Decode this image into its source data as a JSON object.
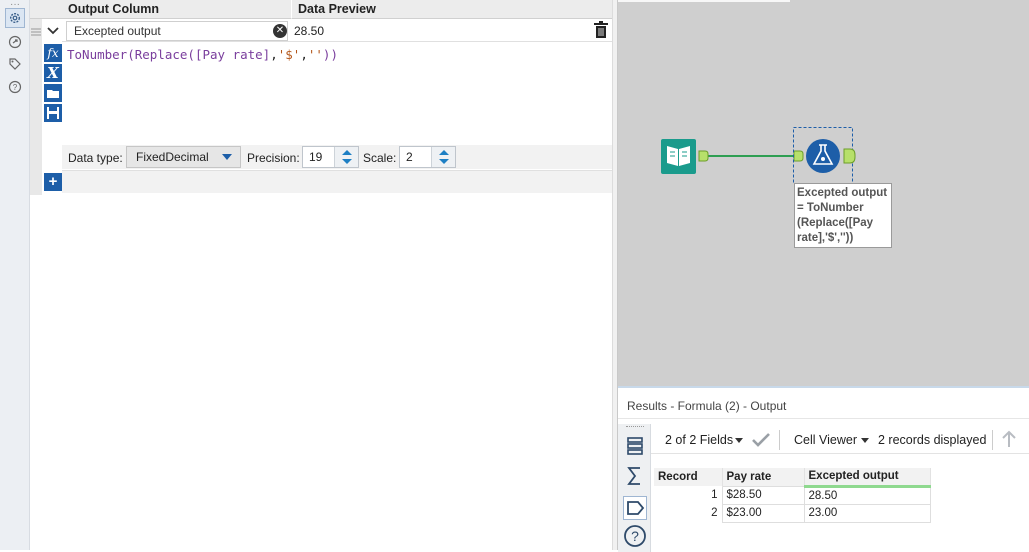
{
  "grid": {
    "headers": {
      "output_column": "Output Column",
      "data_preview": "Data Preview"
    },
    "row": {
      "output_field_name": "Excepted output",
      "preview_value": "28.50",
      "expression": {
        "func1": "ToNumber(",
        "func2": "Replace(",
        "field": "[Pay rate]",
        "comma1": ",",
        "arg1": "'$'",
        "comma2": ",",
        "arg2": "''",
        "close": "))"
      }
    },
    "type_bar": {
      "data_type_label": "Data type:",
      "data_type_value": "FixedDecimal",
      "precision_label": "Precision:",
      "precision_value": "19",
      "scale_label": "Scale:",
      "scale_value": "2"
    }
  },
  "canvas": {
    "annotation_lines": [
      "Excepted output",
      "= ToNumber",
      "(Replace([Pay",
      "rate],'$',''))"
    ],
    "connection_color": "#2e9e52",
    "input_tool_color": "#1a9b8c",
    "formula_tool_color": "#1d5ea8"
  },
  "results": {
    "title": "Results - Formula (2) - Output",
    "fields_selector": "2 of 2 Fields",
    "viewer_selector": "Cell Viewer",
    "record_count": "2 records displayed",
    "columns": [
      "Record",
      "Pay rate",
      "Excepted output"
    ],
    "rows": [
      {
        "record": "1",
        "pay_rate": "$28.50",
        "excepted_output": "28.50"
      },
      {
        "record": "2",
        "pay_rate": "$23.00",
        "excepted_output": "23.00"
      }
    ]
  },
  "colors": {
    "accent": "#1d5ea8",
    "canvas_bg": "#cfcfcf"
  }
}
